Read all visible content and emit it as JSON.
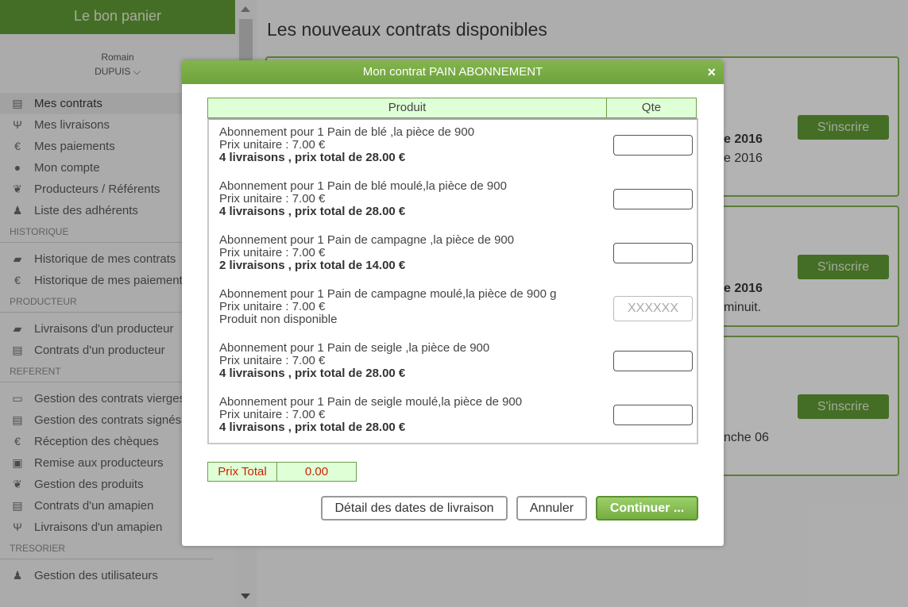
{
  "app": {
    "title": "Le bon panier"
  },
  "user": {
    "first_name": "Romain",
    "last_name": "DUPUIS"
  },
  "menu": {
    "main": [
      {
        "label": "Mes contrats",
        "icon": "document-icon"
      },
      {
        "label": "Mes livraisons",
        "icon": "cutlery-icon"
      },
      {
        "label": "Mes paiements",
        "icon": "euro-icon"
      },
      {
        "label": "Mon compte",
        "icon": "user-icon"
      },
      {
        "label": "Producteurs / Référents",
        "icon": "leaf-icon"
      },
      {
        "label": "Liste des adhérents",
        "icon": "users-icon"
      }
    ],
    "historique_title": "HISTORIQUE",
    "historique": [
      {
        "label": "Historique de mes contrats",
        "icon": "book-icon"
      },
      {
        "label": "Historique de mes paiements",
        "icon": "euro-icon"
      }
    ],
    "producteur_title": "PRODUCTEUR",
    "producteur": [
      {
        "label": "Livraisons d'un producteur",
        "icon": "truck-icon"
      },
      {
        "label": "Contrats d'un producteur",
        "icon": "document-icon"
      }
    ],
    "referent_title": "REFERENT",
    "referent": [
      {
        "label": "Gestion des contrats vierges",
        "icon": "folder-icon"
      },
      {
        "label": "Gestion des contrats signés",
        "icon": "document-icon"
      },
      {
        "label": "Réception des chèques",
        "icon": "euro-icon"
      },
      {
        "label": "Remise aux producteurs",
        "icon": "money-icon"
      },
      {
        "label": "Gestion des produits",
        "icon": "leaf-icon"
      },
      {
        "label": "Contrats d'un amapien",
        "icon": "document-icon"
      },
      {
        "label": "Livraisons d'un amapien",
        "icon": "cutlery-icon"
      }
    ],
    "tresorier_title": "TRESORIER",
    "tresorier": [
      {
        "label": "Gestion des utilisateurs",
        "icon": "users-icon"
      }
    ]
  },
  "main": {
    "title": "Les nouveaux contrats disponibles",
    "cards": [
      {
        "button": "S'inscrire",
        "line1": "e 2016",
        "line2": "e 2016"
      },
      {
        "button": "S'inscrire",
        "line1": "e 2016",
        "line2": "minuit."
      },
      {
        "button": "S'inscrire",
        "line1": "nche 06"
      }
    ]
  },
  "modal": {
    "title": "Mon contrat PAIN ABONNEMENT",
    "close": "×",
    "col_produit": "Produit",
    "col_qte": "Qte",
    "products": [
      {
        "name": "Abonnement pour 1 Pain de blé ,la pièce de 900",
        "price": "Prix unitaire : 7.00 €",
        "total": "4 livraisons , prix total de 28.00 €"
      },
      {
        "name": "Abonnement pour 1 Pain de blé moulé,la pièce de 900",
        "price": "Prix unitaire : 7.00 €",
        "total": "4 livraisons , prix total de 28.00 €"
      },
      {
        "name": "Abonnement pour 1 Pain de campagne ,la pièce de 900",
        "price": "Prix unitaire : 7.00 €",
        "total": "2 livraisons , prix total de 14.00 €"
      },
      {
        "name": "Abonnement pour 1 Pain de campagne moulé,la pièce de 900 g",
        "price": "Prix unitaire : 7.00 €",
        "total": "Produit non disponible",
        "placeholder": "XXXXXX"
      },
      {
        "name": "Abonnement pour 1 Pain de seigle ,la pièce de 900",
        "price": "Prix unitaire : 7.00 €",
        "total": "4 livraisons , prix total de 28.00 €"
      },
      {
        "name": "Abonnement pour 1 Pain de seigle moulé,la pièce de 900",
        "price": "Prix unitaire : 7.00 €",
        "total": "4 livraisons , prix total de 28.00 €"
      }
    ],
    "prix_total_label": "Prix Total",
    "prix_total_value": "0.00",
    "btn_detail": "Détail des dates de livraison",
    "btn_annuler": "Annuler",
    "btn_continuer": "Continuer ..."
  }
}
